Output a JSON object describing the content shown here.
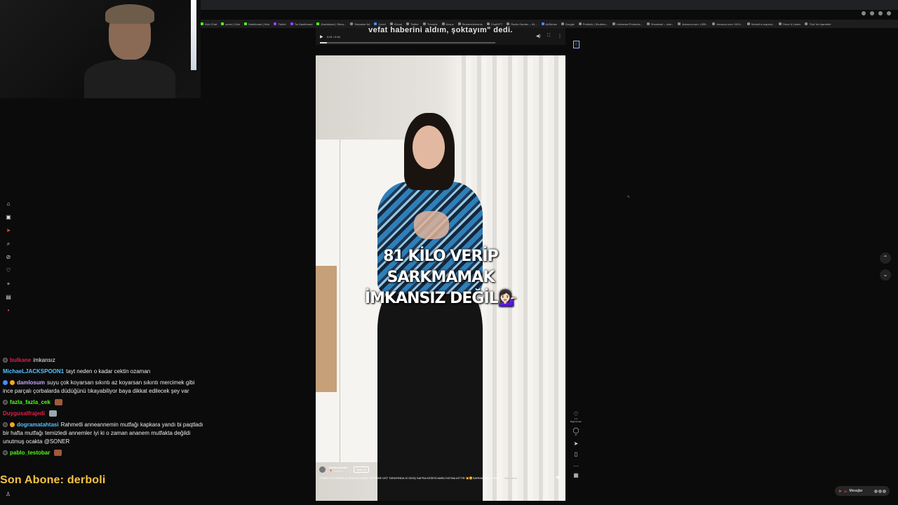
{
  "browser": {
    "bookmarks": [
      "Kick Chat",
      "soner | Kick",
      "Dashboard | Kick",
      "Twitch",
      "Tw Dashboard",
      "Dashboard | Strea...",
      "Streamer Ad",
      "Çeviri",
      "iCloud",
      "Twitter",
      "Threads",
      "Ücsuz",
      "Streamelements",
      "ChatGPT",
      "Radio Garden – Kli...",
      "AdSense",
      "Google",
      "Portfolio | Shutters...",
      "Universal Products...",
      "Shoeinski – vide...",
      "Amazon.com: USB...",
      "Amazon.com: NOV...",
      "Submit a request...",
      "Drive & Listen",
      "Tüm Yer İşaretleri"
    ]
  },
  "audio": {
    "caption": "vefat haberini aldım, şoktayım\" dedi.",
    "time": "0:01 / 0:34",
    "progress": 0.04
  },
  "video": {
    "overlay_line1": "81 KİLO VERİP SARKMAMAK",
    "overlay_line2": "İMKANSIZ DEĞİL💁🏻‍♀️",
    "username": "kelebeminden",
    "location": "📍 Ankara",
    "follow_label": "Takip Et",
    "caption": "GÖBEK DELİĞİNİN ALTINDA Kİ DİKİŞ TÜP MİDE ÜST TARAFINDA Kİ DİKİŞ SAFRA KESESİ AMELİYATINA AİTTİR 💥😊SARKMAMAK TAMA...",
    "more": "daha fazla"
  },
  "actions": {
    "like_count": "1.4",
    "like_label": "Beğenmeler",
    "comment_count": "47"
  },
  "chat": [
    {
      "user": "bulkane",
      "user_color": "#e0204a",
      "message": "imkansız"
    },
    {
      "user": "MichaeLJACKSPOON1",
      "user_color": "#53c4ff",
      "message": "tayt neden o kadar cektin ozaman"
    },
    {
      "user": "damlosum",
      "user_color": "#c7a5ff",
      "message": "suyu çok koyarsan sıkıntı az koyarsan sıkıntı mercimek gibi ince parçalı çorbalarda düdüğünü tıkayabiliyor baya dikkat edilecek şey var"
    },
    {
      "user": "fazla_fazla_cek",
      "user_color": "#53fc18",
      "message": ""
    },
    {
      "user": "Duygusalfrajedi",
      "user_color": "#e0204a",
      "message": ""
    },
    {
      "user": "dogramatahtasi",
      "user_color": "#53c4ff",
      "message": "Rahmetli anneannemin mutfağı kapkara yandı bi paqtladı bir hafta mutfağı temizledi annemler iyi ki o zaman ananem mutfakta değildi unutmuş ocakta @SONER"
    },
    {
      "user": "pablo_testobar",
      "user_color": "#53fc18",
      "message": ""
    }
  ],
  "son_abone": "Son Abone: derboli",
  "messages_label": "Mesajlar",
  "messages_badge": "40",
  "colors": {
    "kick_green": "#53fc18",
    "highlight_yellow": "#f6c343"
  }
}
